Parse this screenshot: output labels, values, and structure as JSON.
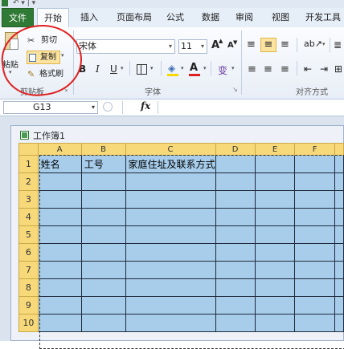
{
  "ribbon_tabs": [
    "文件",
    "开始",
    "插入",
    "页面布局",
    "公式",
    "数据",
    "审阅",
    "视图",
    "开发工具"
  ],
  "clipboard": {
    "paste_label": "粘贴",
    "cut_label": "剪切",
    "copy_label": "复制",
    "format_painter_label": "格式刷",
    "group_label": "剪贴板"
  },
  "font": {
    "name": "宋体",
    "size": "11",
    "grow_label": "A",
    "shrink_label": "A",
    "bold": "B",
    "italic": "I",
    "underline": "U",
    "font_color_label": "A",
    "phonetic_label": "变",
    "group_label": "字体"
  },
  "alignment": {
    "group_label": "对齐方式"
  },
  "formula_bar": {
    "name_box": "G13",
    "fx_label": "fx",
    "formula": ""
  },
  "workbook": {
    "title": "工作簿1"
  },
  "sheet": {
    "columns": [
      "A",
      "B",
      "C",
      "D",
      "E",
      "F"
    ],
    "rows": [
      "1",
      "2",
      "3",
      "4",
      "5",
      "6",
      "7",
      "8",
      "9",
      "10"
    ],
    "cells": {
      "A1": "姓名",
      "B1": "工号",
      "C1": "家庭住址及联系方式"
    }
  },
  "colors": {
    "selection_fill": "#a7cdeb",
    "header_fill": "#f7d97a",
    "annotation_circle": "#e02020",
    "file_tab": "#2f7a35"
  }
}
